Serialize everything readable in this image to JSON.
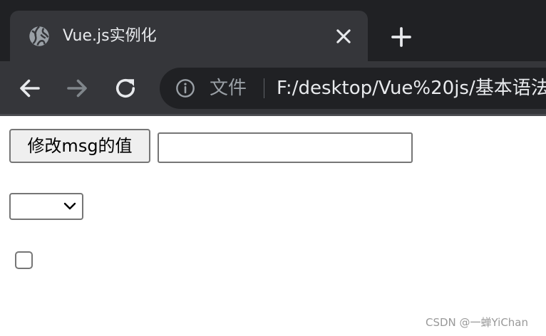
{
  "tab": {
    "title": "Vue.js实例化",
    "favicon_icon": "globe-icon",
    "close_icon": "close-icon"
  },
  "tabstrip": {
    "new_tab_icon": "plus-icon"
  },
  "toolbar": {
    "back_icon": "arrow-left-icon",
    "forward_icon": "arrow-right-icon",
    "reload_icon": "reload-icon",
    "omnibox": {
      "info_icon": "info-icon",
      "scheme_label": "文件",
      "url": "F:/desktop/Vue%20js/基本语法"
    }
  },
  "page": {
    "button_label": "修改msg的值",
    "input_value": "",
    "select_value": "",
    "checkbox_checked": false
  },
  "watermark": "CSDN @一蝉YiChan",
  "colors": {
    "tabstrip_bg": "#202124",
    "tab_bg": "#35363a",
    "omnibox_bg": "#202124",
    "text_light": "#e8eaed",
    "text_dim": "#9aa0a6"
  }
}
